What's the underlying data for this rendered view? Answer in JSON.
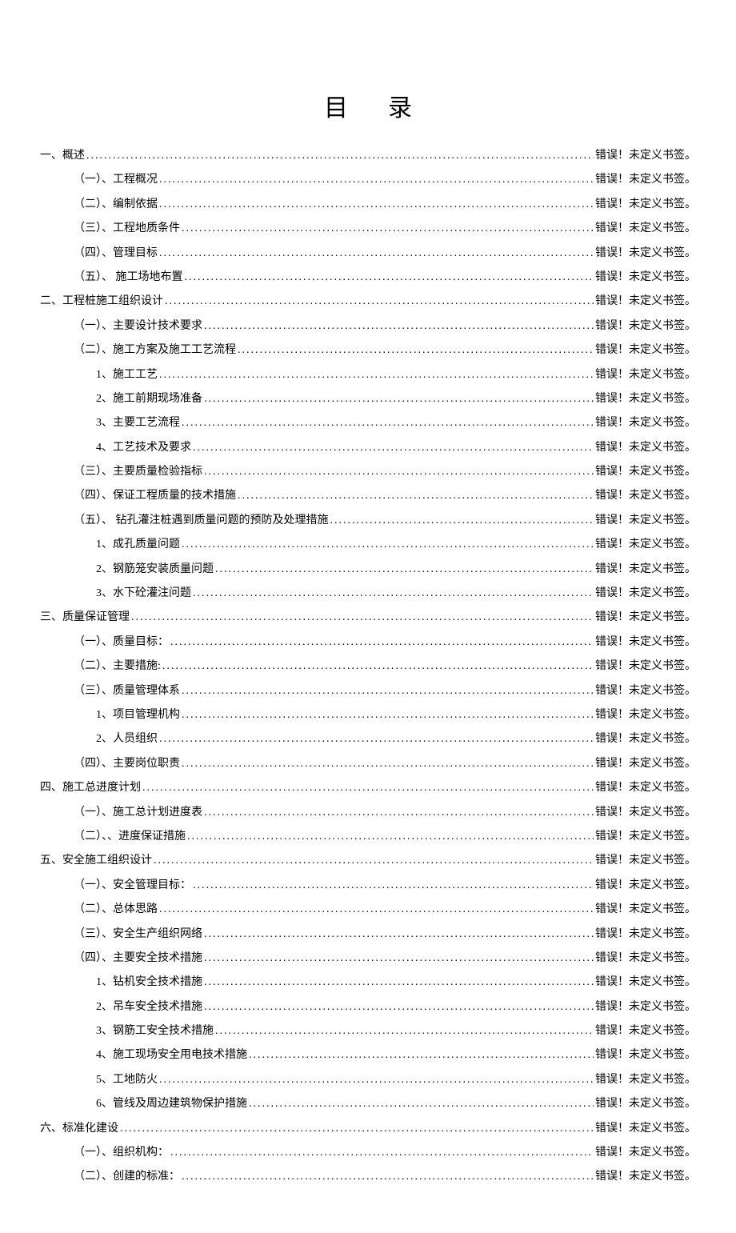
{
  "title": "目录",
  "error_text": "错误！未定义书签。",
  "toc": [
    {
      "level": 0,
      "label": "一、概述"
    },
    {
      "level": 1,
      "label": "（一）、工程概况"
    },
    {
      "level": 1,
      "label": "（二）、编制依据"
    },
    {
      "level": 1,
      "label": "（三）、工程地质条件"
    },
    {
      "level": 1,
      "label": "（四）、管理目标"
    },
    {
      "level": 1,
      "label": "（五）、 施工场地布置"
    },
    {
      "level": 0,
      "label": "二、工程桩施工组织设计"
    },
    {
      "level": 1,
      "label": "（一）、主要设计技术要求"
    },
    {
      "level": 1,
      "label": "（二）、施工方案及施工工艺流程"
    },
    {
      "level": 2,
      "label": "1、施工工艺"
    },
    {
      "level": 2,
      "label": "2、施工前期现场准备"
    },
    {
      "level": 2,
      "label": "3、主要工艺流程"
    },
    {
      "level": 2,
      "label": "4、工艺技术及要求"
    },
    {
      "level": 1,
      "label": "（三）、主要质量检验指标"
    },
    {
      "level": 1,
      "label": "（四）、保证工程质量的技术措施"
    },
    {
      "level": 1,
      "label": "（五）、 钻孔灌注桩遇到质量问题的预防及处理措施"
    },
    {
      "level": 2,
      "label": "1、成孔质量问题"
    },
    {
      "level": 2,
      "label": "2、钢筋笼安装质量问题"
    },
    {
      "level": 2,
      "label": "3、水下砼灌注问题"
    },
    {
      "level": 0,
      "label": "三、质量保证管理"
    },
    {
      "level": 1,
      "label": "（一）、质量目标："
    },
    {
      "level": 1,
      "label": "（二）、主要措施:"
    },
    {
      "level": 1,
      "label": "（三）、质量管理体系"
    },
    {
      "level": 2,
      "label": "1、项目管理机构"
    },
    {
      "level": 2,
      "label": "2、人员组织"
    },
    {
      "level": 1,
      "label": "（四）、主要岗位职责"
    },
    {
      "level": 0,
      "label": "四、施工总进度计划"
    },
    {
      "level": 1,
      "label": "（一）、施工总计划进度表"
    },
    {
      "level": 1,
      "label": "（二）、、进度保证措施"
    },
    {
      "level": 0,
      "label": "五、安全施工组织设计"
    },
    {
      "level": 1,
      "label": "（一）、安全管理目标："
    },
    {
      "level": 1,
      "label": "（二）、总体思路"
    },
    {
      "level": 1,
      "label": "（三）、安全生产组织网络"
    },
    {
      "level": 1,
      "label": "（四）、主要安全技术措施"
    },
    {
      "level": 2,
      "label": "1、钻机安全技术措施"
    },
    {
      "level": 2,
      "label": "2、吊车安全技术措施"
    },
    {
      "level": 2,
      "label": "3、钢筋工安全技术措施"
    },
    {
      "level": 2,
      "label": "4、施工现场安全用电技术措施"
    },
    {
      "level": 2,
      "label": "5、工地防火"
    },
    {
      "level": 2,
      "label": "6、管线及周边建筑物保护措施"
    },
    {
      "level": 0,
      "label": "六、标准化建设"
    },
    {
      "level": 1,
      "label": "（一）、组织机构："
    },
    {
      "level": 1,
      "label": "（二）、创建的标准："
    }
  ]
}
